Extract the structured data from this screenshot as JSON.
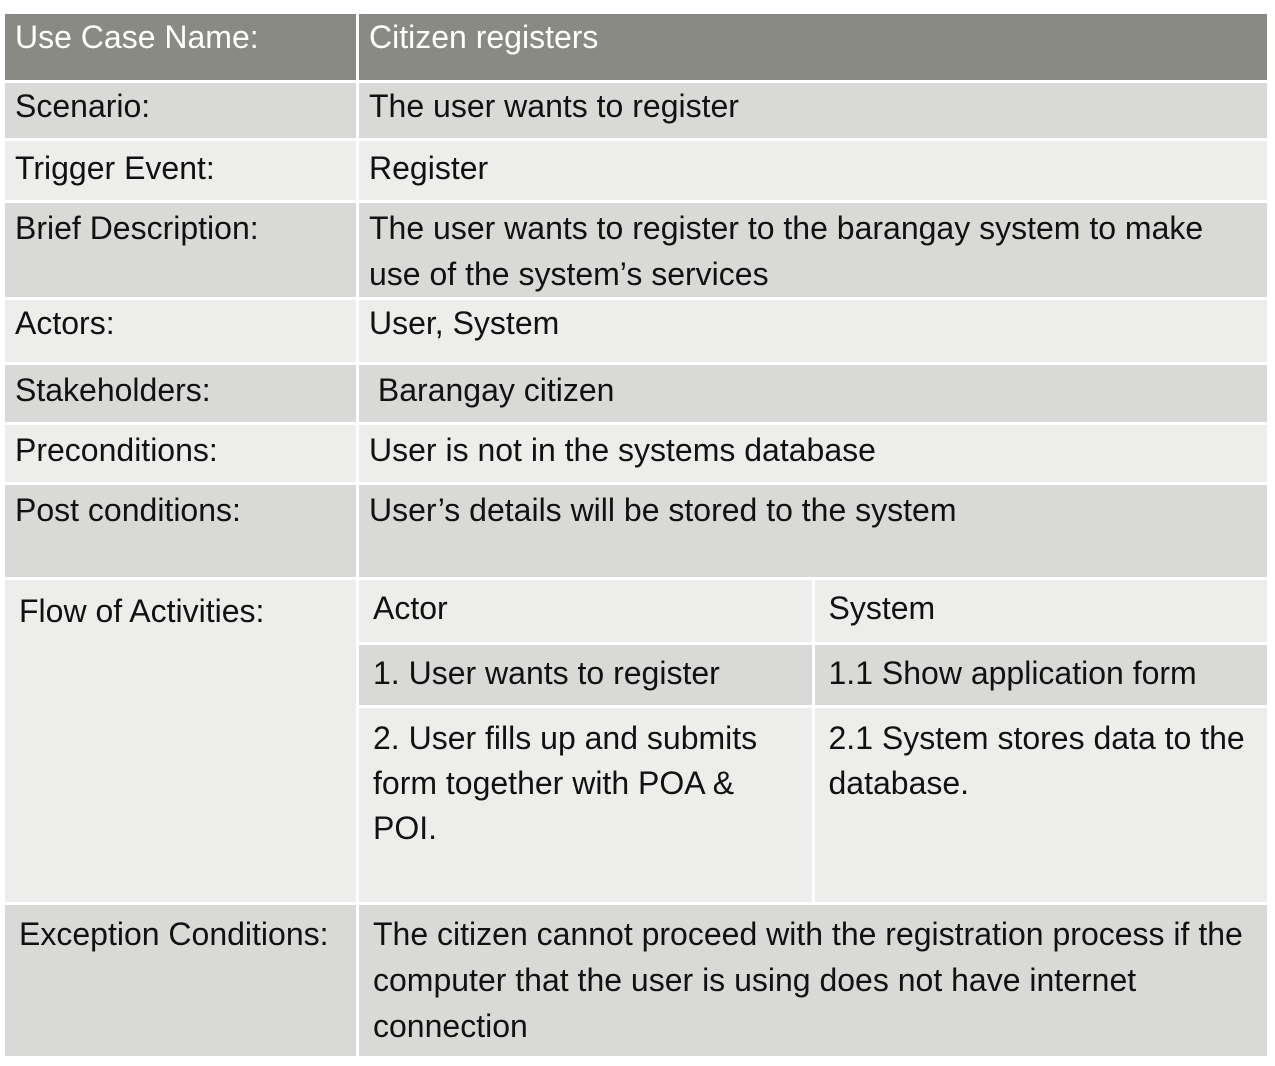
{
  "use_case": {
    "header": {
      "label": "Use Case Name:",
      "value": "Citizen registers"
    },
    "rows": [
      {
        "label": "Scenario:",
        "value": "The user wants to register"
      },
      {
        "label": "Trigger Event:",
        "value": "Register"
      },
      {
        "label": "Brief Description:",
        "value": "The user wants to register to the barangay system to make use of the system’s services"
      },
      {
        "label": "Actors:",
        "value": "User, System"
      },
      {
        "label": "Stakeholders:",
        "value": " Barangay citizen"
      },
      {
        "label": "Preconditions:",
        "value": "User is not in the systems database"
      },
      {
        "label": "Post conditions:",
        "value": "User’s details will be stored to the system"
      }
    ],
    "flow": {
      "label": "Flow of Activities:",
      "columns": [
        "Actor",
        "System"
      ],
      "steps": [
        {
          "actor": "1. User wants to register",
          "system": "1.1 Show application form"
        },
        {
          "actor": "2. User fills up and submits form together with POA & POI.",
          "system": "2.1 System stores data to the database."
        }
      ]
    },
    "exception": {
      "label": "Exception Conditions:",
      "value": "The citizen cannot proceed with the registration process if the computer that the user is using does not have internet connection"
    }
  }
}
